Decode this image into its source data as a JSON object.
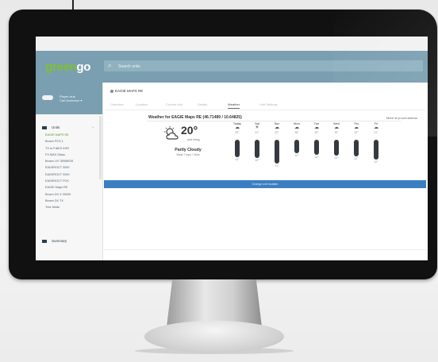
{
  "app": {
    "logo_main": "green",
    "logo_accent": "go"
  },
  "header": {
    "search_placeholder": "Search units"
  },
  "sidebar": {
    "user_name": "Player club",
    "user_detail": "Carl Anderson ▾",
    "section_label": "Units",
    "items": [
      {
        "label": "EAGIE MAPS RE",
        "active": true
      },
      {
        "label": "Brown PCS 1",
        "active": false
      },
      {
        "label": "TX to FullKX AXR",
        "active": false
      },
      {
        "label": "FX MAX Glass",
        "active": false
      },
      {
        "label": "Brown LIV 35958SIS",
        "active": false
      },
      {
        "label": "EADSROCT 3000",
        "active": false
      },
      {
        "label": "EADSROCT 0000",
        "active": false
      },
      {
        "label": "EADSROCT PCK",
        "active": false
      },
      {
        "label": "EAGIE Maps RE",
        "active": false
      },
      {
        "label": "Brown DX X 00000",
        "active": false
      },
      {
        "label": "Brown DX TX",
        "active": false
      },
      {
        "label": "Tree Mode",
        "active": false
      }
    ],
    "footer_label": "Summary"
  },
  "main": {
    "device_title": "EAGIE MAPS RE",
    "tabs": [
      {
        "label": "Overview",
        "active": false
      },
      {
        "label": "Location",
        "active": false
      },
      {
        "label": "Current Info",
        "active": false
      },
      {
        "label": "Details",
        "active": false
      },
      {
        "label": "Weather",
        "active": true
      },
      {
        "label": "Unit Settings",
        "active": false
      }
    ],
    "weather_title": "Weather for EAGIE Maps RE (46.71489 / 10.64825)",
    "weather_link": "More at yr.no/Lanbrau",
    "current": {
      "temp": "20°",
      "unit": "and rising",
      "condition": "Partly Cloudy",
      "detail": "Wind 7 mps / 3m/s"
    },
    "forecast": [
      {
        "day": "Today",
        "icon": "partly-cloudy-icon",
        "glyph": "☁",
        "high": "20°",
        "low": "14°",
        "bar_fraction": 0.72
      },
      {
        "day": "Sat",
        "icon": "sun-icon",
        "glyph": "☀",
        "high": "21°",
        "low": "13°",
        "bar_fraction": 0.78
      },
      {
        "day": "Sun",
        "icon": "cloud-sun-icon",
        "glyph": "☁",
        "high": "22°",
        "low": "11°",
        "bar_fraction": 1.0
      },
      {
        "day": "Mon",
        "icon": "cloud-icon",
        "glyph": "☁",
        "high": "18°",
        "low": "12°",
        "bar_fraction": 0.55
      },
      {
        "day": "Tue",
        "icon": "cloud-icon",
        "glyph": "☁",
        "high": "19°",
        "low": "12°",
        "bar_fraction": 0.62
      },
      {
        "day": "Wed",
        "icon": "cloud-icon",
        "glyph": "☁",
        "high": "19°",
        "low": "13°",
        "bar_fraction": 0.68
      },
      {
        "day": "Thu",
        "icon": "cloud-icon",
        "glyph": "☁",
        "high": "20°",
        "low": "12°",
        "bar_fraction": 0.7
      },
      {
        "day": "Fri",
        "icon": "cloud-icon",
        "glyph": "☁",
        "high": "21°",
        "low": "12°",
        "bar_fraction": 0.84
      }
    ],
    "cta_label": "Change unit location"
  },
  "colors": {
    "header": "#7a9fb0",
    "brand_green": "#7ec12e",
    "cta": "#3b7fc2"
  }
}
